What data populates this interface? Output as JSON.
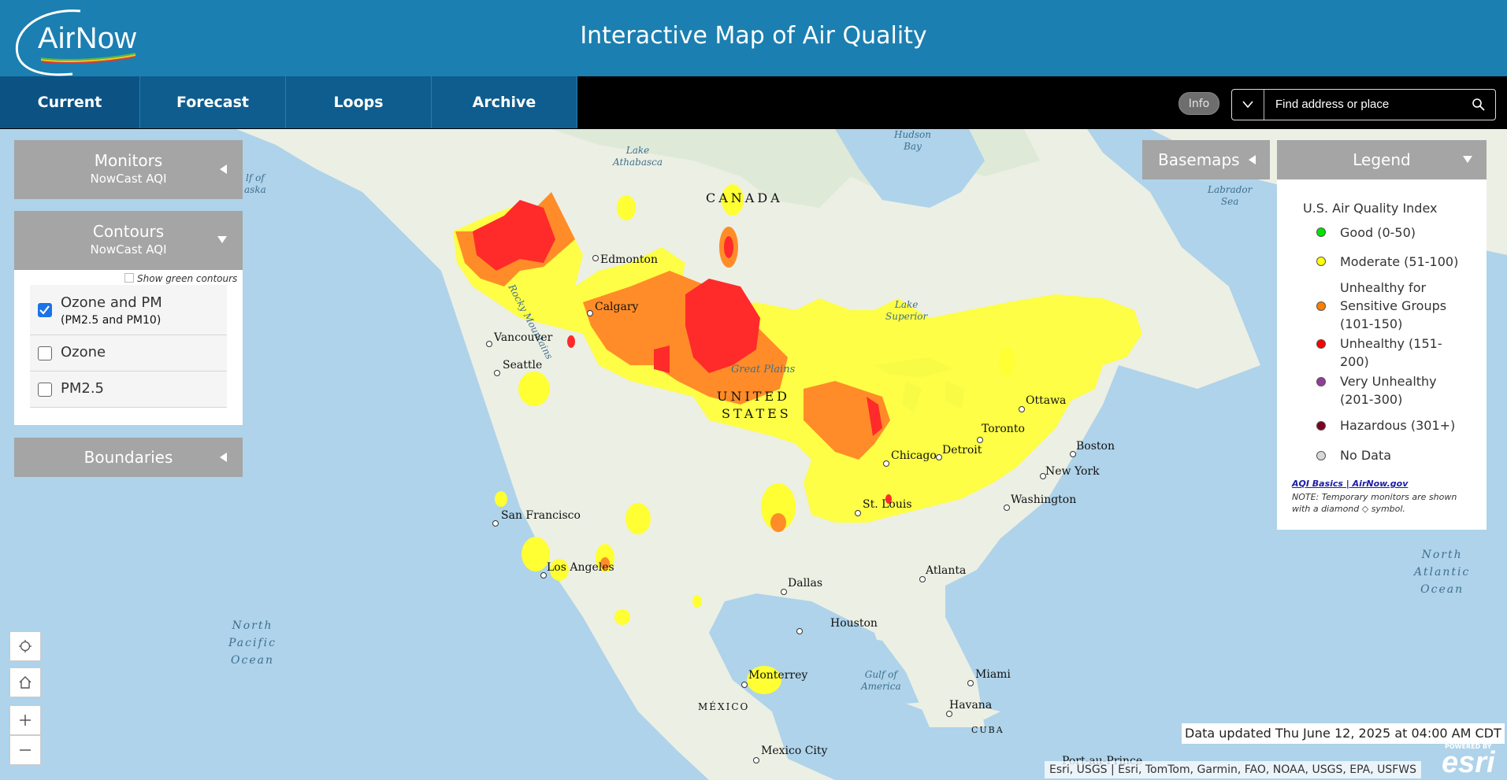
{
  "header": {
    "logo_text": "AirNow",
    "title": "Interactive Map of Air Quality"
  },
  "nav": {
    "tabs": [
      {
        "label": "Current",
        "active": true
      },
      {
        "label": "Forecast",
        "active": false
      },
      {
        "label": "Loops",
        "active": false
      },
      {
        "label": "Archive",
        "active": false
      }
    ],
    "info_label": "Info",
    "search_placeholder": "Find address or place"
  },
  "monitors": {
    "title": "Monitors",
    "subtitle": "NowCast AQI"
  },
  "contours": {
    "title": "Contours",
    "subtitle": "NowCast AQI",
    "show_green_label": "Show green contours",
    "show_green_checked": false,
    "options": [
      {
        "label": "Ozone and PM",
        "sub": "(PM2.5 and PM10)",
        "checked": true
      },
      {
        "label": "Ozone",
        "sub": "",
        "checked": false
      },
      {
        "label": "PM2.5",
        "sub": "",
        "checked": false
      }
    ]
  },
  "boundaries": {
    "title": "Boundaries"
  },
  "basemaps": {
    "title": "Basemaps"
  },
  "legend": {
    "title": "Legend",
    "index_title": "U.S. Air Quality Index",
    "items": [
      {
        "label": "Good (0-50)",
        "color": "#00e400"
      },
      {
        "label": "Moderate (51-100)",
        "color": "#ffff00"
      },
      {
        "label": "Unhealthy for Sensitive Groups (101-150)",
        "color": "#ff7e00"
      },
      {
        "label": "Unhealthy (151-200)",
        "color": "#ff0000"
      },
      {
        "label": "Very Unhealthy (201-300)",
        "color": "#8f3f97"
      },
      {
        "label": "Hazardous (301+)",
        "color": "#7e0023"
      },
      {
        "label": "No Data",
        "color": "#d8d8d8"
      }
    ],
    "link_text": "AQI Basics | AirNow.gov",
    "note": "NOTE: Temporary monitors are shown with a diamond ◇ symbol."
  },
  "map": {
    "labels": {
      "canada": "CANADA",
      "usa_line1": "UNITED",
      "usa_line2": "STATES",
      "mexico": "MÉXICO",
      "cuba": "CUBA",
      "north_pacific": [
        "North",
        "Pacific",
        "Ocean"
      ],
      "north_atlantic": [
        "North",
        "Atlantic",
        "Ocean"
      ],
      "hudson_bay": [
        "Hudson",
        "Bay"
      ],
      "labrador_sea": [
        "Labrador",
        "Sea"
      ],
      "gulf_of_alaska": [
        "lf of",
        "aska"
      ],
      "gulf_of_america": [
        "Gulf of",
        "America"
      ],
      "lake_athabasca": [
        "Lake",
        "Athabasca"
      ],
      "lake_superior": [
        "Lake",
        "Superior"
      ],
      "great_plains": "Great Plains",
      "rocky_mountains": "Rocky Mountains"
    },
    "cities": [
      {
        "name": "Edmonton"
      },
      {
        "name": "Calgary"
      },
      {
        "name": "Vancouver"
      },
      {
        "name": "Seattle"
      },
      {
        "name": "San Francisco"
      },
      {
        "name": "Los Angeles"
      },
      {
        "name": "Dallas"
      },
      {
        "name": "Houston"
      },
      {
        "name": "Monterrey"
      },
      {
        "name": "Mexico City"
      },
      {
        "name": "Chicago"
      },
      {
        "name": "St. Louis"
      },
      {
        "name": "Detroit"
      },
      {
        "name": "Toronto"
      },
      {
        "name": "Ottawa"
      },
      {
        "name": "Boston"
      },
      {
        "name": "New York"
      },
      {
        "name": "Washington"
      },
      {
        "name": "Atlanta"
      },
      {
        "name": "Miami"
      },
      {
        "name": "Havana"
      },
      {
        "name": "Port-au-Prince"
      }
    ],
    "updated": "Data updated Thu June 12, 2025 at 04:00 AM CDT",
    "attribution": "Esri, USGS | Esri, TomTom, Garmin, FAO, NOAA, USGS, EPA, USFWS",
    "esri_powered": "POWERED BY",
    "esri_logo": "esri"
  },
  "colors": {
    "header_bg": "#1b7fb1",
    "nav_bg": "#000000",
    "tab_bg": "#0e5d8e",
    "panel_gray": "#a5a5a5",
    "moderate": "#ffff33",
    "usg": "#ff8c28",
    "unhealthy": "#ff2a2a"
  }
}
